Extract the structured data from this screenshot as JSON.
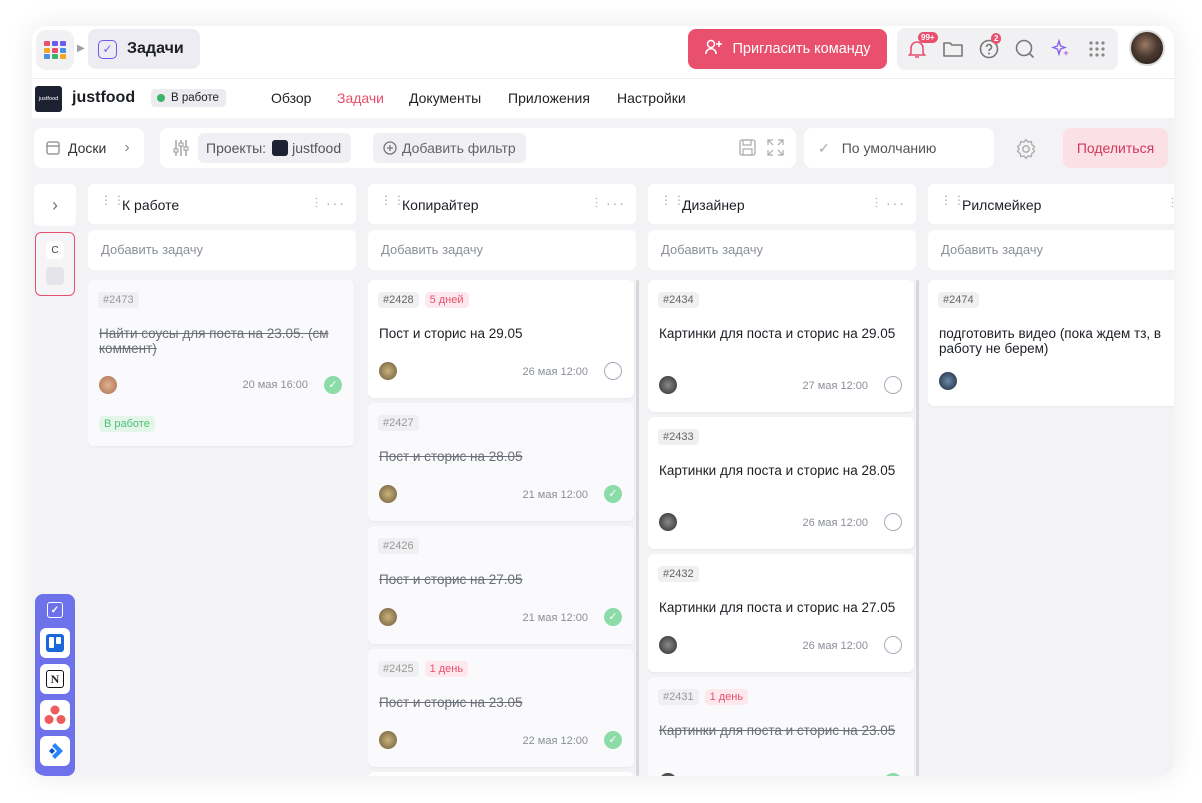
{
  "header": {
    "title": "Задачи",
    "invite_label": "Пригласить команду",
    "notif_badge": "99+",
    "help_badge": "2"
  },
  "project": {
    "name": "justfood",
    "logo_text": "justfood",
    "status": "В работе",
    "tabs": [
      "Обзор",
      "Задачи",
      "Документы",
      "Приложения",
      "Настройки"
    ],
    "active_tab": "Задачи"
  },
  "toolbar": {
    "view_label": "Доски",
    "projects_label": "Проекты:",
    "project_chip": "justfood",
    "add_filter": "Добавить фильтр",
    "sort_label": "По умолчанию",
    "share_label": "Поделиться"
  },
  "rail": {
    "letter": "C"
  },
  "add_task_label": "Добавить задачу",
  "columns": [
    {
      "name": "К работе",
      "cards": [
        {
          "id": "#2473",
          "deadline": "",
          "title": "Найти соусы для поста на 23.05. (см коммент)",
          "date": "20 мая 16:00",
          "done": true,
          "status": "В работе"
        }
      ]
    },
    {
      "name": "Копирайтер",
      "cards": [
        {
          "id": "#2428",
          "deadline": "5 дней",
          "title": "Пост и сторис на 29.05",
          "date": "26 мая 12:00",
          "done": false
        },
        {
          "id": "#2427",
          "deadline": "",
          "title": "Пост и сторис на 28.05",
          "date": "21 мая 12:00",
          "done": true
        },
        {
          "id": "#2426",
          "deadline": "",
          "title": "Пост и сторис на 27.05",
          "date": "21 мая 12:00",
          "done": true
        },
        {
          "id": "#2425",
          "deadline": "1 день",
          "title": "Пост и сторис на 23.05",
          "date": "22 мая 12:00",
          "done": true
        }
      ]
    },
    {
      "name": "Дизайнер",
      "cards": [
        {
          "id": "#2434",
          "deadline": "",
          "title": "Картинки для поста и сторис на 29.05",
          "date": "27 мая 12:00",
          "done": false
        },
        {
          "id": "#2433",
          "deadline": "",
          "title": "Картинки для поста и сторис на 28.05",
          "date": "26 мая 12:00",
          "done": false
        },
        {
          "id": "#2432",
          "deadline": "",
          "title": "Картинки для поста и сторис на 27.05",
          "date": "26 мая 12:00",
          "done": false
        },
        {
          "id": "#2431",
          "deadline": "1 день",
          "title": "Картинки для поста и сторис на 23.05",
          "date": "",
          "done": true
        }
      ]
    },
    {
      "name": "Рилсмейкер",
      "cards": [
        {
          "id": "#2474",
          "deadline": "",
          "title": "подготовить видео (пока ждем тз, в работу не берем)",
          "date": "",
          "done": false
        }
      ]
    }
  ],
  "icons": [
    "apps-grid-icon",
    "checkbox-icon",
    "user-plus-icon",
    "bell-icon",
    "folder-icon",
    "help-icon",
    "search-icon",
    "sparkles-icon",
    "dots-grid-icon",
    "board-icon",
    "chevron-right-icon",
    "sliders-icon",
    "plus-circle-icon",
    "save-icon",
    "expand-icon",
    "check-icon",
    "gear-icon",
    "trello-icon",
    "notion-icon",
    "asana-icon",
    "jira-icon"
  ],
  "colors": {
    "accent": "#e8506d",
    "brand_purple": "#6b5cf0",
    "success": "#3bb36a"
  }
}
